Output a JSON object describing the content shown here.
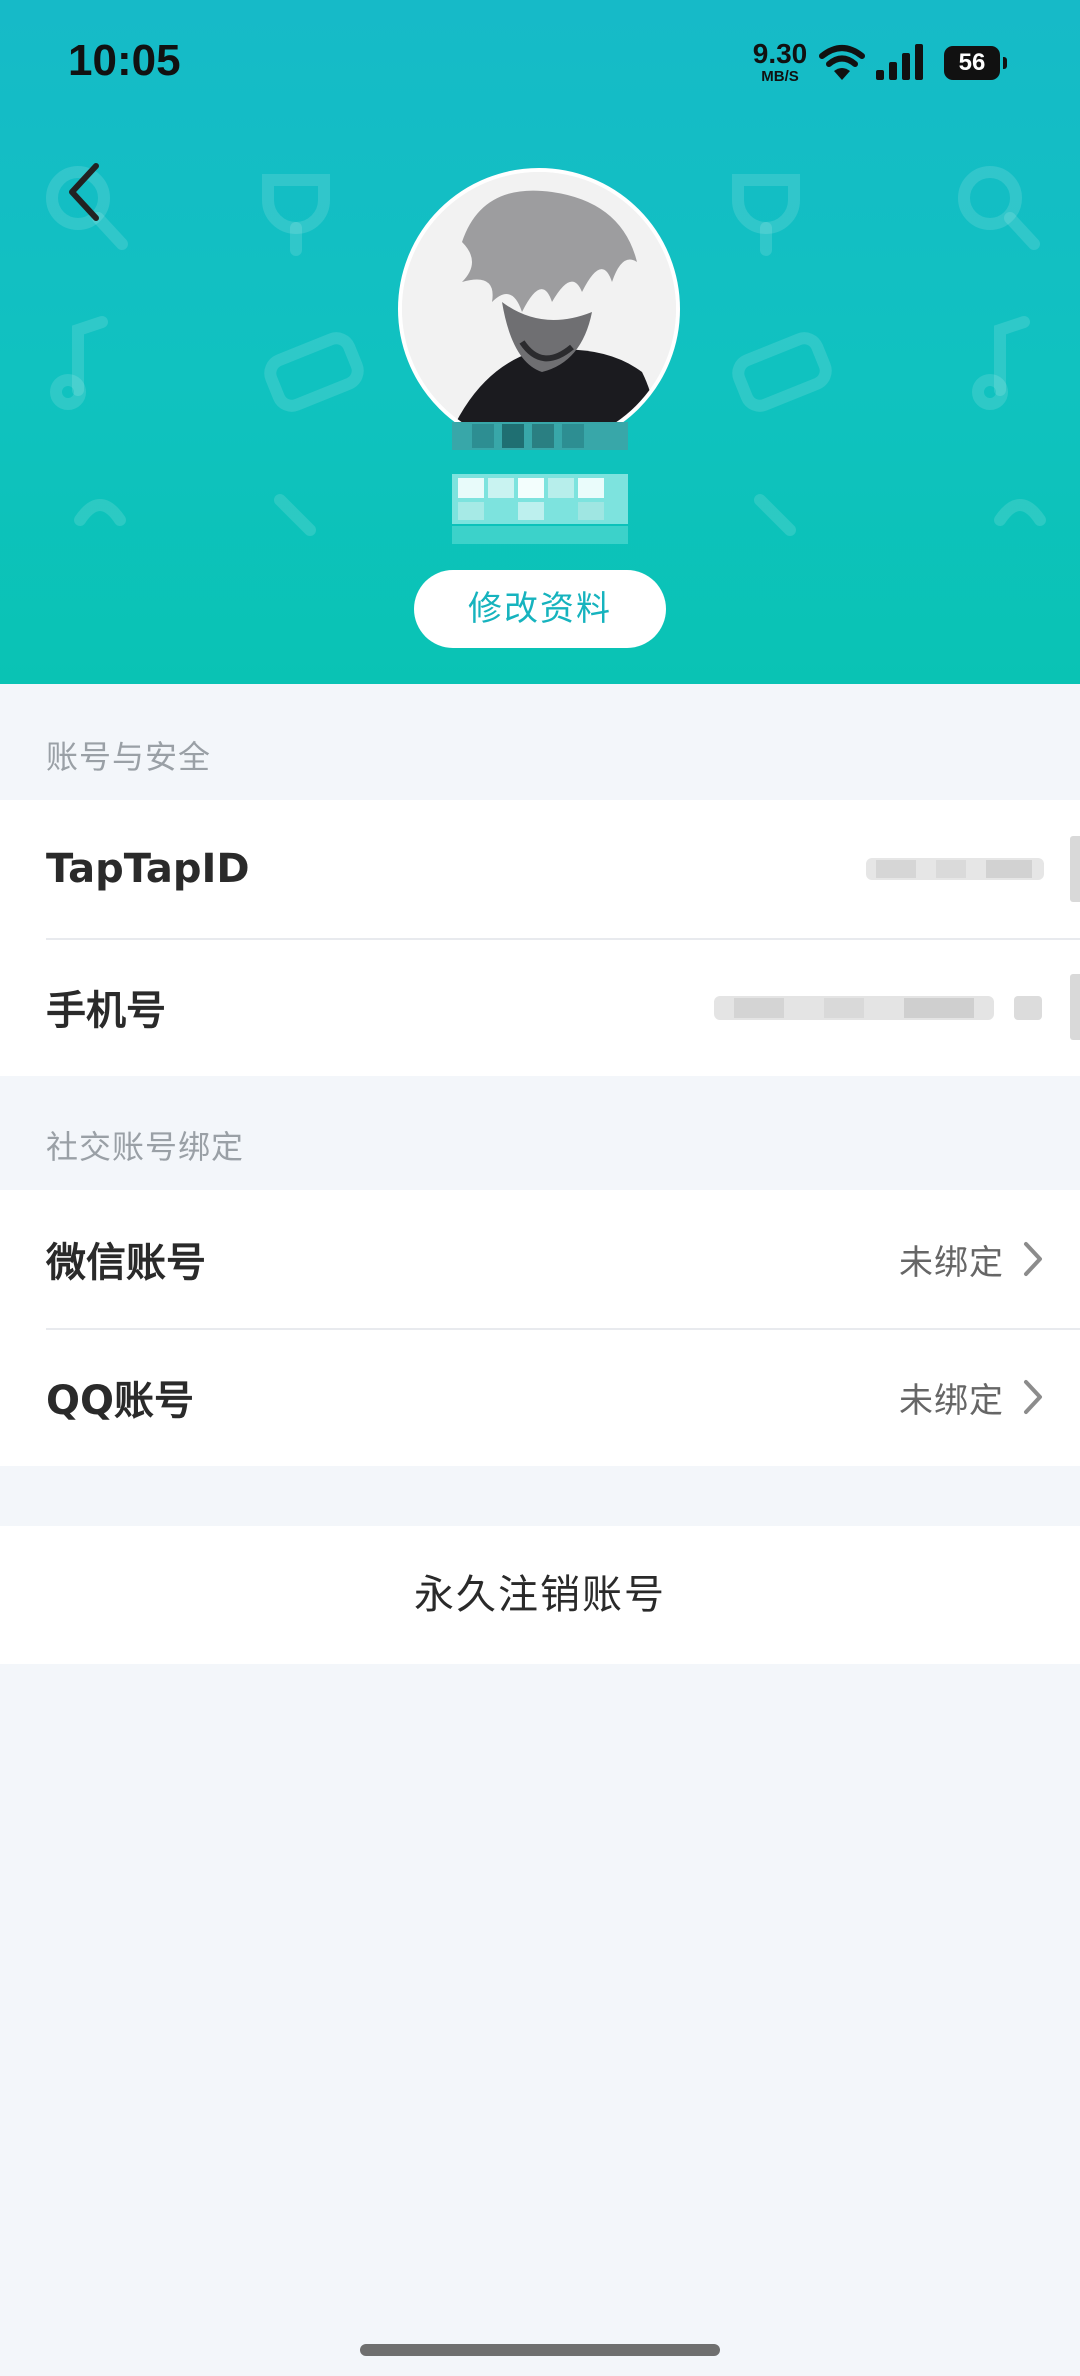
{
  "status_bar": {
    "time": "10:05",
    "net_speed": "9.30",
    "net_unit": "MB/S",
    "battery": "56",
    "icons": [
      "wifi-icon",
      "signal-icon",
      "battery-icon"
    ]
  },
  "header": {
    "back_icon": "chevron-left-icon",
    "avatar_alt": "avatar",
    "edit_profile_label": "修改资料",
    "bg_color_top": "#16BAC8",
    "bg_color_bottom": "#09C3B4",
    "accent": "#16B3BE"
  },
  "sections": [
    {
      "title": "账号与安全",
      "rows": [
        {
          "label": "TapTapID",
          "value": ""
        },
        {
          "label": "手机号",
          "value": ""
        }
      ]
    },
    {
      "title": "社交账号绑定",
      "rows": [
        {
          "label": "微信账号",
          "value": "未绑定"
        },
        {
          "label": "QQ账号",
          "value": "未绑定"
        }
      ]
    }
  ],
  "delete_account_label": "永久注销账号"
}
